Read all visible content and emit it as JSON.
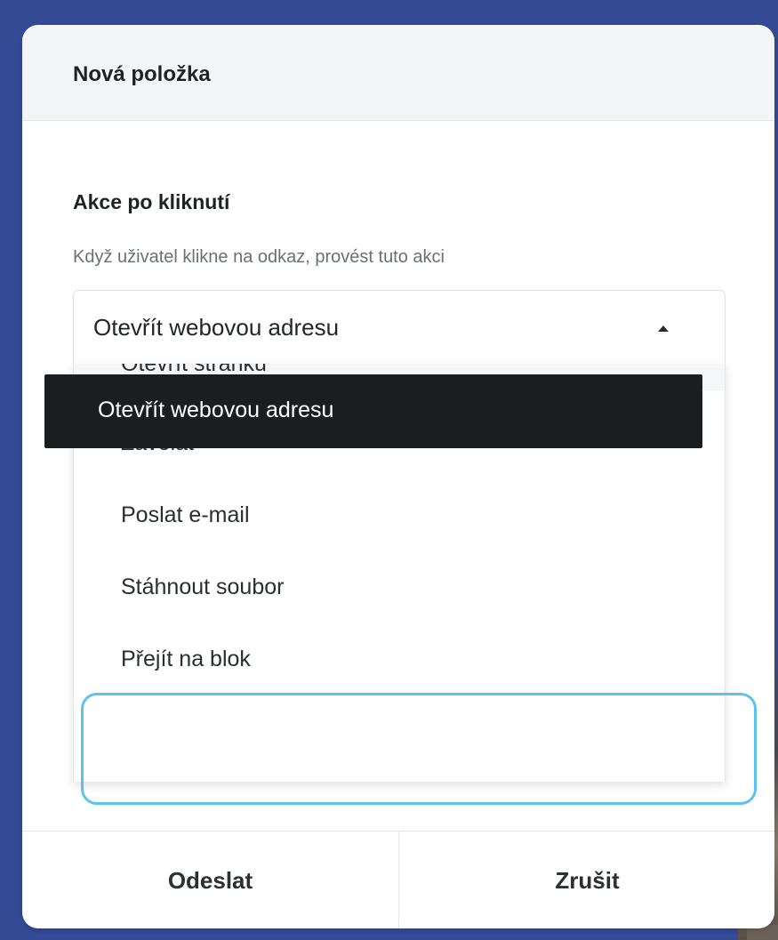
{
  "dialog": {
    "title": "Nová položka"
  },
  "click_action": {
    "label": "Akce po kliknutí",
    "help": "Když uživatel klikne na odkaz, provést tuto akci",
    "selected_value": "Otevřít webovou adresu",
    "options": [
      {
        "label": "Otevřít stránku"
      },
      {
        "label": "Zavolat"
      },
      {
        "label": "Poslat e-mail"
      },
      {
        "label": "Stáhnout soubor"
      },
      {
        "label": "Přejít na blok"
      },
      {
        "label": "Otevřít webovou adresu",
        "selected": true
      }
    ]
  },
  "footer": {
    "submit_label": "Odeslat",
    "cancel_label": "Zrušit"
  },
  "colors": {
    "backdrop": "#344a94",
    "selected_option_bg": "#1a1e21",
    "focus_ring": "#5ec2ee"
  }
}
